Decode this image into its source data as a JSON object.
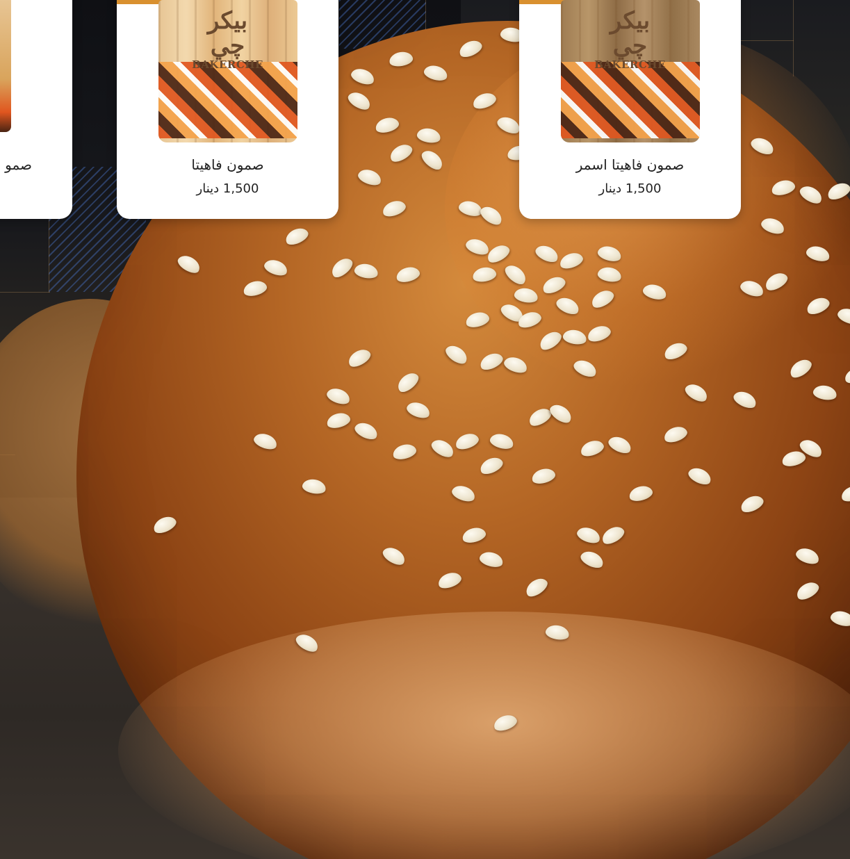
{
  "colors": {
    "accent": "#d9902f",
    "card_bg": "#ffffff",
    "text": "#222222"
  },
  "products": [
    {
      "name": "صمو",
      "price": "",
      "brand": "",
      "brand_glyph": "",
      "bag_style": "light"
    },
    {
      "name": "صمون فاهيتا",
      "price": "1,500 دينار",
      "brand": "BAKERCHE",
      "brand_glyph": "بيكر\nچي",
      "bag_style": "light"
    },
    {
      "name": "صمون فاهيتا اسمر",
      "price": "1,500 دينار",
      "brand": "BAKERCHE",
      "brand_glyph": "بيكر\nچي",
      "bag_style": "brown"
    }
  ]
}
